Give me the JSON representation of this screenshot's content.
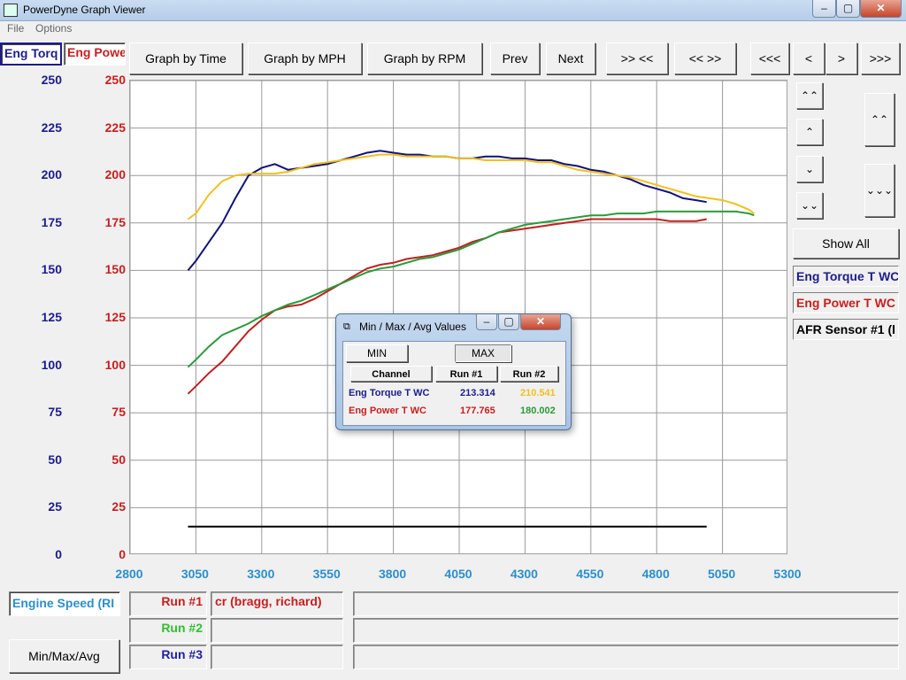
{
  "window": {
    "title": "PowerDyne Graph Viewer",
    "min": "–",
    "max": "▢",
    "close": "✕"
  },
  "menu": {
    "file": "File",
    "options": "Options"
  },
  "channel_tabs": {
    "torque": "Eng Torq",
    "power": "Eng Powe"
  },
  "toolbar": {
    "graph_time": "Graph by Time",
    "graph_mph": "Graph by MPH",
    "graph_rpm": "Graph by RPM",
    "prev": "Prev",
    "next": "Next",
    "zoom_in": ">> <<",
    "zoom_out": "<< >>",
    "first": "<<<",
    "back": "<",
    "forward": ">",
    "last": ">>>"
  },
  "side": {
    "up_fast": "⌃⌃",
    "up": "⌃",
    "down": "⌄",
    "down_fast": "⌄⌄",
    "right_up2": "⌃⌃",
    "right_down2": "⌄⌄",
    "right_down3": "⌄⌄⌄",
    "show_all": "Show All",
    "labels": [
      "Eng Torque T WC",
      "Eng Power T WC",
      "AFR Sensor #1 (l"
    ]
  },
  "bottom": {
    "x_channel": "Engine Speed (RI",
    "runs": [
      "Run #1",
      "Run #2",
      "Run #3"
    ],
    "run1_name": "cr (bragg, richard)",
    "minmax_button": "Min/Max/Avg"
  },
  "dialog": {
    "title": "Min / Max / Avg Values",
    "min_button": "MIN",
    "max_button": "MAX",
    "col_channel": "Channel",
    "col_run1": "Run #1",
    "col_run2": "Run #2",
    "rows": [
      {
        "channel": "Eng Torque T WC",
        "run1": "213.314",
        "run2": "210.541"
      },
      {
        "channel": "Eng Power T WC",
        "run1": "177.765",
        "run2": "180.002"
      }
    ]
  },
  "colors": {
    "torque_axis": "#1c1c8c",
    "power_axis": "#c81e1e",
    "x_axis": "#2b8fc9",
    "run1_torque": "#12127a",
    "run2_torque": "#f0c020",
    "run1_power": "#c02020",
    "run2_power": "#2a9a3a",
    "run2_label": "#30c030",
    "run3_label": "#2020a0"
  },
  "chart_data": {
    "type": "line",
    "xlabel": "",
    "ylabel": "",
    "x_ticks": [
      2800,
      3050,
      3300,
      3550,
      3800,
      4050,
      4300,
      4550,
      4800,
      5050,
      5300
    ],
    "xlim": [
      2800,
      5300
    ],
    "y_ticks": [
      0,
      25,
      50,
      75,
      100,
      125,
      150,
      175,
      200,
      225,
      250
    ],
    "ylim": [
      0,
      250
    ],
    "grid": true,
    "series": [
      {
        "name": "Eng Torque T WC",
        "color": "#12127a",
        "points": [
          [
            3020,
            150
          ],
          [
            3050,
            155
          ],
          [
            3100,
            165
          ],
          [
            3150,
            175
          ],
          [
            3200,
            188
          ],
          [
            3250,
            200
          ],
          [
            3300,
            204
          ],
          [
            3350,
            206
          ],
          [
            3400,
            203
          ],
          [
            3450,
            204
          ],
          [
            3500,
            205
          ],
          [
            3550,
            206
          ],
          [
            3600,
            208
          ],
          [
            3650,
            210
          ],
          [
            3700,
            212
          ],
          [
            3750,
            213
          ],
          [
            3800,
            212
          ],
          [
            3850,
            211
          ],
          [
            3900,
            211
          ],
          [
            3950,
            210
          ],
          [
            4000,
            210
          ],
          [
            4050,
            209
          ],
          [
            4100,
            209
          ],
          [
            4150,
            210
          ],
          [
            4200,
            210
          ],
          [
            4250,
            209
          ],
          [
            4300,
            209
          ],
          [
            4350,
            208
          ],
          [
            4400,
            208
          ],
          [
            4450,
            206
          ],
          [
            4500,
            205
          ],
          [
            4550,
            203
          ],
          [
            4600,
            202
          ],
          [
            4650,
            200
          ],
          [
            4700,
            198
          ],
          [
            4750,
            195
          ],
          [
            4800,
            193
          ],
          [
            4850,
            191
          ],
          [
            4900,
            188
          ],
          [
            4950,
            187
          ],
          [
            4990,
            186
          ]
        ]
      },
      {
        "name": "Eng Torque T WC",
        "color": "#f0c020",
        "points": [
          [
            3020,
            177
          ],
          [
            3050,
            180
          ],
          [
            3100,
            190
          ],
          [
            3150,
            197
          ],
          [
            3200,
            200
          ],
          [
            3250,
            201
          ],
          [
            3300,
            201
          ],
          [
            3350,
            201
          ],
          [
            3400,
            202
          ],
          [
            3450,
            204
          ],
          [
            3500,
            206
          ],
          [
            3550,
            207
          ],
          [
            3600,
            208
          ],
          [
            3650,
            209
          ],
          [
            3700,
            210
          ],
          [
            3750,
            211
          ],
          [
            3800,
            211
          ],
          [
            3850,
            210
          ],
          [
            3900,
            210
          ],
          [
            3950,
            210
          ],
          [
            4000,
            210
          ],
          [
            4050,
            209
          ],
          [
            4100,
            209
          ],
          [
            4150,
            208
          ],
          [
            4200,
            208
          ],
          [
            4250,
            208
          ],
          [
            4300,
            208
          ],
          [
            4350,
            207
          ],
          [
            4400,
            207
          ],
          [
            4450,
            205
          ],
          [
            4500,
            203
          ],
          [
            4550,
            202
          ],
          [
            4600,
            201
          ],
          [
            4650,
            200
          ],
          [
            4700,
            199
          ],
          [
            4750,
            197
          ],
          [
            4800,
            195
          ],
          [
            4850,
            193
          ],
          [
            4900,
            191
          ],
          [
            4950,
            189
          ],
          [
            5000,
            188
          ],
          [
            5050,
            187
          ],
          [
            5100,
            185
          ],
          [
            5150,
            182
          ],
          [
            5170,
            180
          ]
        ]
      },
      {
        "name": "Eng Power T WC",
        "color": "#c02020",
        "points": [
          [
            3020,
            85
          ],
          [
            3050,
            89
          ],
          [
            3100,
            96
          ],
          [
            3150,
            102
          ],
          [
            3200,
            110
          ],
          [
            3250,
            118
          ],
          [
            3300,
            124
          ],
          [
            3350,
            129
          ],
          [
            3400,
            131
          ],
          [
            3450,
            132
          ],
          [
            3500,
            135
          ],
          [
            3550,
            139
          ],
          [
            3600,
            143
          ],
          [
            3650,
            147
          ],
          [
            3700,
            151
          ],
          [
            3750,
            153
          ],
          [
            3800,
            154
          ],
          [
            3850,
            156
          ],
          [
            3900,
            157
          ],
          [
            3950,
            158
          ],
          [
            4000,
            160
          ],
          [
            4050,
            162
          ],
          [
            4100,
            165
          ],
          [
            4150,
            167
          ],
          [
            4200,
            170
          ],
          [
            4250,
            171
          ],
          [
            4300,
            172
          ],
          [
            4350,
            173
          ],
          [
            4400,
            174
          ],
          [
            4450,
            175
          ],
          [
            4500,
            176
          ],
          [
            4550,
            177
          ],
          [
            4600,
            177
          ],
          [
            4650,
            177
          ],
          [
            4700,
            177
          ],
          [
            4750,
            177
          ],
          [
            4800,
            177
          ],
          [
            4850,
            176
          ],
          [
            4900,
            176
          ],
          [
            4950,
            176
          ],
          [
            4990,
            177
          ]
        ]
      },
      {
        "name": "Eng Power T WC",
        "color": "#2a9a3a",
        "points": [
          [
            3020,
            99
          ],
          [
            3050,
            103
          ],
          [
            3100,
            110
          ],
          [
            3150,
            116
          ],
          [
            3200,
            119
          ],
          [
            3250,
            122
          ],
          [
            3300,
            126
          ],
          [
            3350,
            129
          ],
          [
            3400,
            132
          ],
          [
            3450,
            134
          ],
          [
            3500,
            137
          ],
          [
            3550,
            140
          ],
          [
            3600,
            143
          ],
          [
            3650,
            146
          ],
          [
            3700,
            149
          ],
          [
            3750,
            151
          ],
          [
            3800,
            152
          ],
          [
            3850,
            154
          ],
          [
            3900,
            156
          ],
          [
            3950,
            157
          ],
          [
            4000,
            159
          ],
          [
            4050,
            161
          ],
          [
            4100,
            164
          ],
          [
            4150,
            167
          ],
          [
            4200,
            170
          ],
          [
            4250,
            172
          ],
          [
            4300,
            174
          ],
          [
            4350,
            175
          ],
          [
            4400,
            176
          ],
          [
            4450,
            177
          ],
          [
            4500,
            178
          ],
          [
            4550,
            179
          ],
          [
            4600,
            179
          ],
          [
            4650,
            180
          ],
          [
            4700,
            180
          ],
          [
            4750,
            180
          ],
          [
            4800,
            181
          ],
          [
            4850,
            181
          ],
          [
            4900,
            181
          ],
          [
            4950,
            181
          ],
          [
            5000,
            181
          ],
          [
            5050,
            181
          ],
          [
            5100,
            181
          ],
          [
            5150,
            180
          ],
          [
            5170,
            179
          ]
        ]
      },
      {
        "name": "",
        "color": "#000000",
        "points": [
          [
            3020,
            15
          ],
          [
            4990,
            15
          ]
        ]
      }
    ]
  }
}
